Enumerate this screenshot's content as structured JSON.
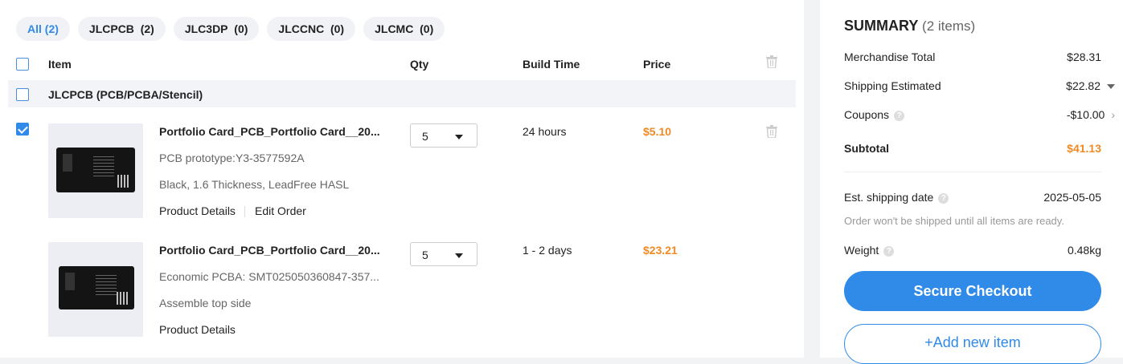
{
  "tabs": [
    {
      "label": "All",
      "count": "(2)"
    },
    {
      "label": "JLCPCB",
      "count": "(2)"
    },
    {
      "label": "JLC3DP",
      "count": "(0)"
    },
    {
      "label": "JLCCNC",
      "count": "(0)"
    },
    {
      "label": "JLCMC",
      "count": "(0)"
    }
  ],
  "columns": {
    "item": "Item",
    "qty": "Qty",
    "build_time": "Build Time",
    "price": "Price"
  },
  "group": {
    "label": "JLCPCB (PCB/PCBA/Stencil)"
  },
  "items": [
    {
      "title": "Portfolio Card_PCB_Portfolio Card__20...",
      "line1": "PCB prototype:Y3-3577592A",
      "line2": "Black, 1.6 Thickness, LeadFree HASL",
      "link1": "Product Details",
      "link2": "Edit Order",
      "qty": "5",
      "build_time": "24 hours",
      "price": "$5.10",
      "checked": true,
      "card_text": "Nico Brooks"
    },
    {
      "title": "Portfolio Card_PCB_Portfolio Card__20...",
      "line1": "Economic PCBA: SMT025050360847-357...",
      "line2": "Assemble top side",
      "link1": "Product Details",
      "qty": "5",
      "build_time": "1 - 2 days",
      "price": "$23.21",
      "card_text": "Nico Brooks"
    }
  ],
  "summary": {
    "title": "SUMMARY",
    "count": "(2 items)",
    "merchandise_label": "Merchandise Total",
    "merchandise_value": "$28.31",
    "shipping_label": "Shipping Estimated",
    "shipping_value": "$22.82",
    "coupons_label": "Coupons",
    "coupons_value": "-$10.00",
    "subtotal_label": "Subtotal",
    "subtotal_value": "$41.13",
    "ship_date_label": "Est. shipping date",
    "ship_date_value": "2025-05-05",
    "note": "Order won't be shipped until all items are ready.",
    "weight_label": "Weight",
    "weight_value": "0.48kg",
    "checkout_label": "Secure Checkout",
    "add_label": "+Add new item"
  },
  "colors": {
    "accent": "#2f8ae8",
    "price": "#f08a24"
  }
}
